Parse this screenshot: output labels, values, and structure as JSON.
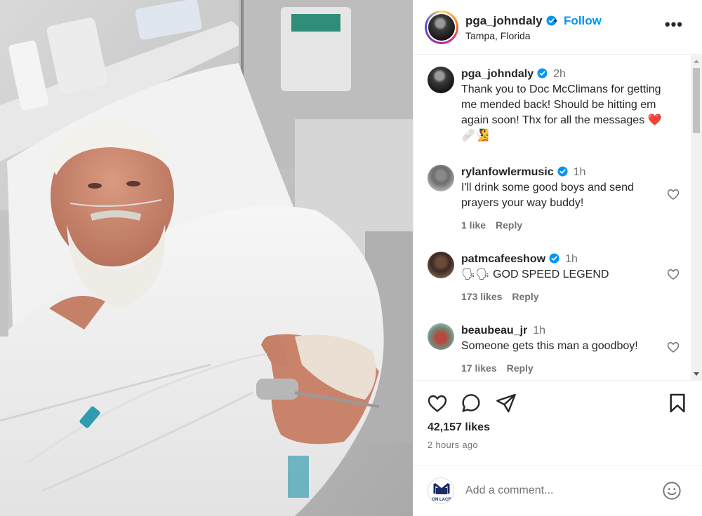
{
  "post": {
    "author": "pga_johndaly",
    "location": "Tampa, Florida",
    "follow_label": "Follow",
    "separator": "•",
    "more_label": "•••"
  },
  "caption": {
    "user": "pga_johndaly",
    "time": "2h",
    "text": "Thank you to Doc McClimans for getting me mended back! Should be hitting em again soon! Thx for all the messages ❤️🩹🧏"
  },
  "comments": [
    {
      "user": "rylanfowlermusic",
      "time": "1h",
      "text": "I'll drink some good boys and send prayers your way buddy!",
      "likes": "1 like",
      "reply": "Reply"
    },
    {
      "user": "patmcafeeshow",
      "time": "1h",
      "text": "🗣🗣 GOD SPEED LEGEND",
      "likes": "173 likes",
      "reply": "Reply"
    },
    {
      "user": "beaubeau_jr",
      "time": "1h",
      "text": "Someone gets this man a goodboy!",
      "likes": "17 likes",
      "reply": "Reply"
    }
  ],
  "stats": {
    "likes": "42,157 likes",
    "posted": "2 hours ago"
  },
  "add_comment": {
    "placeholder": "Add a comment...",
    "avatar_text": "ON LACR"
  },
  "icons": {
    "like": "heart-icon",
    "comment": "comment-bubble-icon",
    "share": "paper-plane-icon",
    "save": "bookmark-icon",
    "emoji": "smiley-icon",
    "verified": "verified-badge-icon"
  },
  "colors": {
    "accent": "#0095f6",
    "verified": "#0095f6",
    "text": "#262626",
    "muted": "#737373"
  }
}
